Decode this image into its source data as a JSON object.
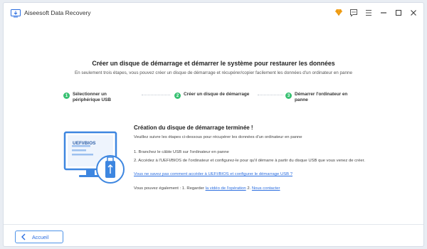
{
  "app": {
    "title": "Aiseesoft Data Recovery"
  },
  "titlebar": {
    "icons": [
      "premium-icon",
      "feedback-icon",
      "menu-icon",
      "minimize-icon",
      "maximize-icon",
      "close-icon"
    ]
  },
  "header": {
    "title": "Créer un disque de démarrage et démarrer le système pour restaurer les données",
    "subtitle": "En seulement trois étapes, vous pouvez créer un disque de démarrage et récupérer/copier facilement les données d'un ordinateur en panne"
  },
  "steps": [
    {
      "number": "1",
      "label": "Sélectionner un périphérique USB"
    },
    {
      "number": "2",
      "label": "Créer un disque de démarrage"
    },
    {
      "number": "3",
      "label": "Démarrer l'ordinateur en panne"
    }
  ],
  "illustration": {
    "screen_label": "UEFI/BIOS"
  },
  "content": {
    "title": "Création du disque de démarrage terminée !",
    "intro": "Veuillez suivre les étapes ci-dessous pour récupérer les données d'un ordinateur en panne",
    "step1": "1. Branchez le câble USB sur l'ordinateur en panne",
    "step2": "2. Accédez à l'UEFI/BIOS de l'ordinateur et configurez-le pour qu'il démarre à partir du disque USB que vous venez de créer.",
    "help_link": "Vous ne savez pas comment accéder à UEFI/BIOS et configurer le démarrage USB ?",
    "also_prefix": "Vous pouvez également : 1. Regarder ",
    "video_link": "la vidéo de l'opération",
    "also_middle": " 2. ",
    "contact_link": "Nous contacter"
  },
  "footer": {
    "back_label": "Accueil"
  },
  "colors": {
    "accent": "#2a6de0",
    "step_green": "#38c172",
    "illustration_blue": "#3d86e0"
  }
}
